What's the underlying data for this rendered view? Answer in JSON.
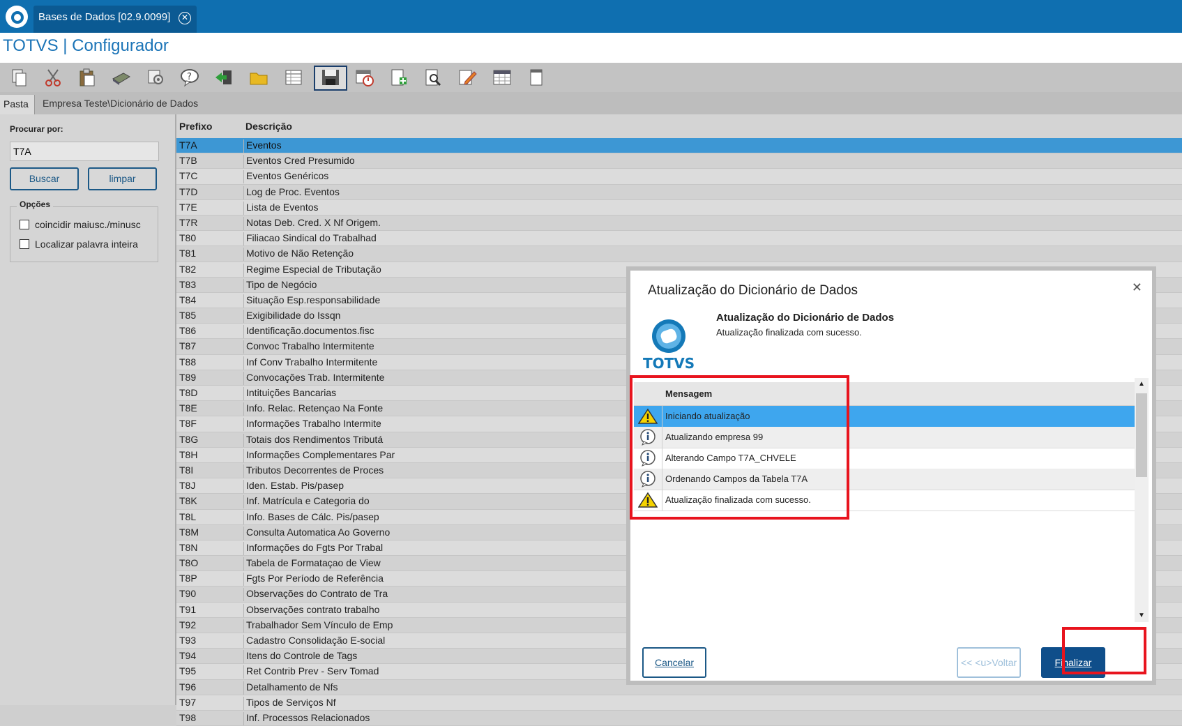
{
  "tab": {
    "title": "Bases de Dados [02.9.0099]",
    "close": "✕"
  },
  "app_title": "TOTVS | Configurador",
  "toolbar": {
    "buttons": [
      "copy-icon",
      "cut-icon",
      "paste-icon",
      "book-icon",
      "gears-icon",
      "help-icon",
      "exit-icon",
      "folder-icon",
      "table-icon",
      "save-icon",
      "calendar-clock-icon",
      "add-doc-icon",
      "search-doc-icon",
      "edit-icon",
      "grid-icon",
      "page-icon"
    ]
  },
  "folder": {
    "tab": "Pasta",
    "breadcrumb": "Empresa Teste\\Dicionário de Dados"
  },
  "left": {
    "search_label": "Procurar por:",
    "search_value": "T7A",
    "buscar": "Buscar",
    "limpar": "limpar",
    "options_label": "Opções",
    "opt1": "coincidir maiusc./minusc",
    "opt2": "Localizar palavra inteira"
  },
  "grid": {
    "headers": {
      "prefixo": "Prefixo",
      "descricao": "Descrição"
    },
    "rows": [
      [
        "T7A",
        "Eventos"
      ],
      [
        "T7B",
        "Eventos Cred Presumido"
      ],
      [
        "T7C",
        "Eventos Genéricos"
      ],
      [
        "T7D",
        "Log de Proc. Eventos"
      ],
      [
        "T7E",
        "Lista de Eventos"
      ],
      [
        "T7R",
        "Notas Deb. Cred. X Nf Origem."
      ],
      [
        "T80",
        "Filiacao Sindical do Trabalhad"
      ],
      [
        "T81",
        "Motivo de Não Retenção"
      ],
      [
        "T82",
        "Regime Especial de Tributação"
      ],
      [
        "T83",
        "Tipo de Negócio"
      ],
      [
        "T84",
        "Situação Esp.responsabilidade"
      ],
      [
        "T85",
        "Exigibilidade do Issqn"
      ],
      [
        "T86",
        "Identificação.documentos.fisc"
      ],
      [
        "T87",
        "Convoc Trabalho Intermitente"
      ],
      [
        "T88",
        "Inf Conv Trabalho Intermitente"
      ],
      [
        "T89",
        "Convocações Trab. Intermitente"
      ],
      [
        "T8D",
        "Intituições Bancarias"
      ],
      [
        "T8E",
        "Info. Relac. Retençao Na Fonte"
      ],
      [
        "T8F",
        "Informações Trabalho Intermite"
      ],
      [
        "T8G",
        "Totais dos Rendimentos Tributá"
      ],
      [
        "T8H",
        "Informações Complementares Par"
      ],
      [
        "T8I",
        "Tributos Decorrentes de Proces"
      ],
      [
        "T8J",
        "Iden. Estab. Pis/pasep"
      ],
      [
        "T8K",
        "Inf. Matrícula e Categoria do"
      ],
      [
        "T8L",
        "Info. Bases de Cálc. Pis/pasep"
      ],
      [
        "T8M",
        "Consulta Automatica Ao Governo"
      ],
      [
        "T8N",
        "Informações do Fgts Por Trabal"
      ],
      [
        "T8O",
        "Tabela de Formataçao de View"
      ],
      [
        "T8P",
        "Fgts Por Período de Referência"
      ],
      [
        "T90",
        "Observações do Contrato de Tra"
      ],
      [
        "T91",
        "Observações contrato trabalho"
      ],
      [
        "T92",
        "Trabalhador Sem Vínculo de Emp"
      ],
      [
        "T93",
        "Cadastro Consolidação E-social"
      ],
      [
        "T94",
        "Itens do Controle de Tags"
      ],
      [
        "T95",
        "Ret Contrib Prev - Serv Tomad"
      ],
      [
        "T96",
        "Detalhamento de Nfs"
      ],
      [
        "T97",
        "Tipos de Serviços Nf"
      ],
      [
        "T98",
        "Inf. Processos Relacionados"
      ]
    ]
  },
  "modal": {
    "title": "Atualização do Dicionário de Dados",
    "close": "✕",
    "logo_text": "TOTVS",
    "sub_title": "Atualização do Dicionário de Dados",
    "sub_text": "Atualização finalizada com sucesso.",
    "msg_header": "Mensagem",
    "messages": [
      {
        "icon": "warning-icon",
        "text": "Iniciando atualização"
      },
      {
        "icon": "info-icon",
        "text": "Atualizando empresa 99"
      },
      {
        "icon": "info-icon",
        "text": "Alterando Campo T7A_CHVELE"
      },
      {
        "icon": "info-icon",
        "text": "Ordenando Campos da Tabela T7A"
      },
      {
        "icon": "warning-icon",
        "text": "Atualização finalizada com sucesso."
      }
    ],
    "cancelar": "Cancelar",
    "voltar": "<< <u>Voltar",
    "finalizar": "Finalizar",
    "scroll_up": "▲",
    "scroll_down": "▼"
  },
  "colors": {
    "accent": "#0f6fb0",
    "highlight": "#e8141e",
    "selected_row": "#3d97d4"
  }
}
